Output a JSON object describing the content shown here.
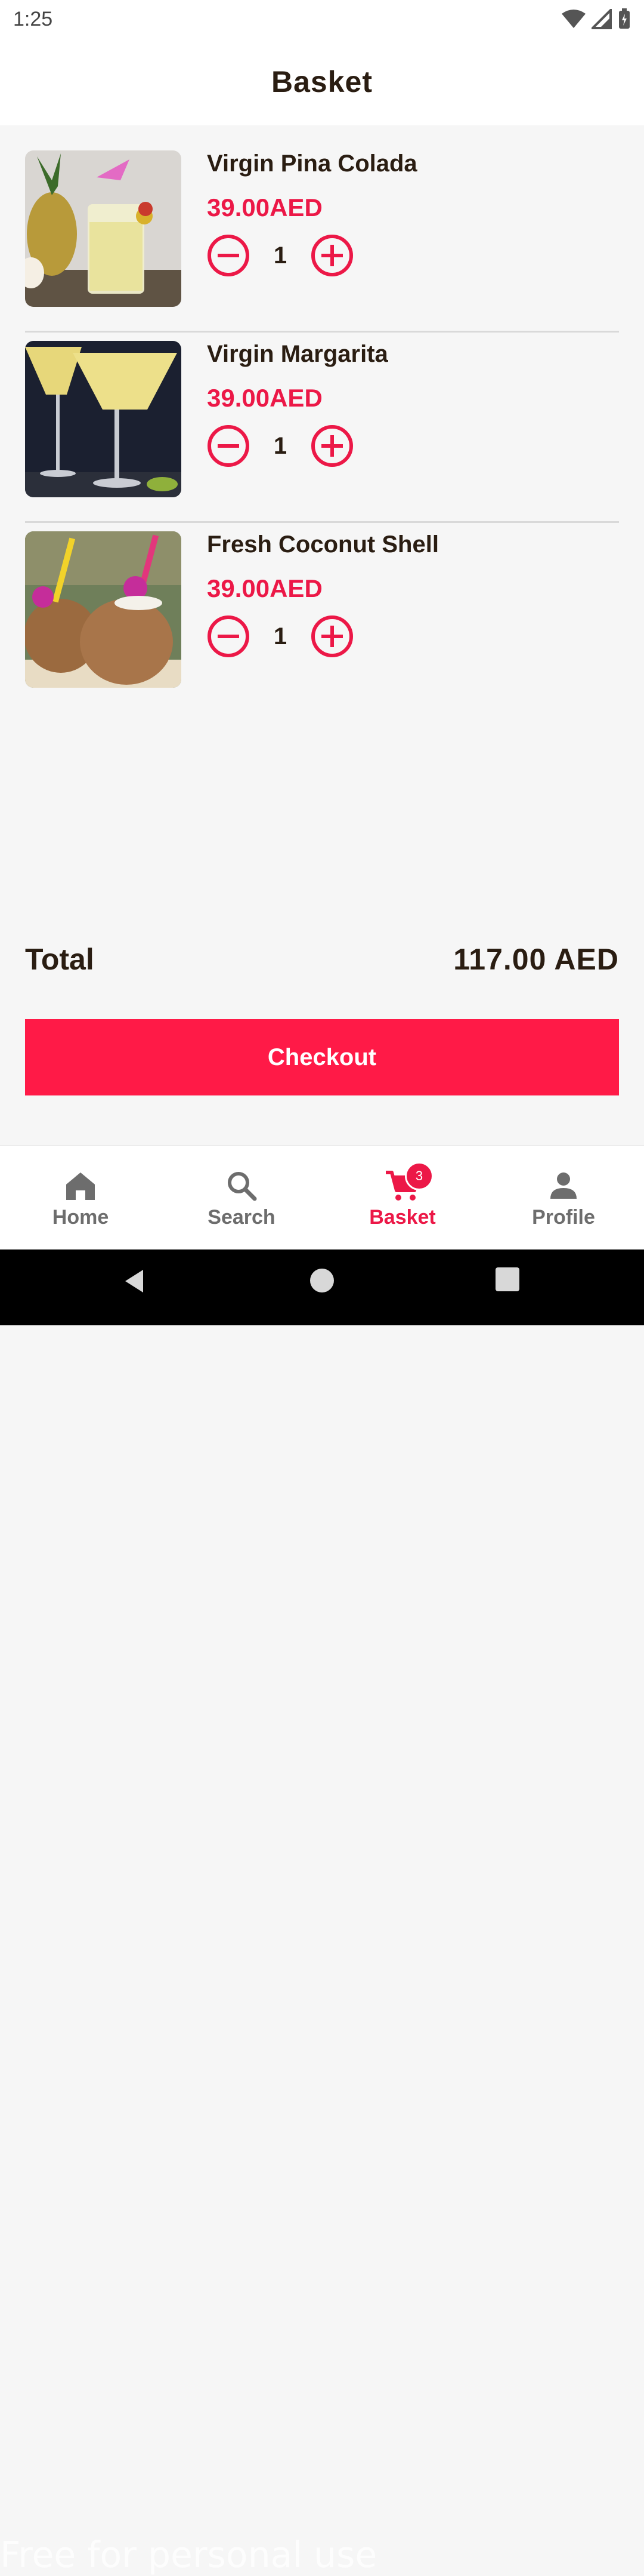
{
  "status_bar": {
    "time": "1:25"
  },
  "header": {
    "title": "Basket"
  },
  "items": [
    {
      "name": "Virgin Pina Colada",
      "price": "39.00AED",
      "quantity": "1"
    },
    {
      "name": "Virgin Margarita",
      "price": "39.00AED",
      "quantity": "1"
    },
    {
      "name": "Fresh Coconut Shell",
      "price": "39.00AED",
      "quantity": "1"
    }
  ],
  "summary": {
    "total_label": "Total",
    "total_value": "117.00 AED"
  },
  "checkout": {
    "label": "Checkout"
  },
  "bottom_nav": {
    "items": [
      {
        "label": "Home",
        "icon": "home-icon"
      },
      {
        "label": "Search",
        "icon": "search-icon"
      },
      {
        "label": "Basket",
        "icon": "cart-icon",
        "badge": "3",
        "active": true
      },
      {
        "label": "Profile",
        "icon": "person-icon"
      }
    ]
  },
  "watermark": "Free for personal use",
  "colors": {
    "accent": "#ec1847",
    "button": "#ff1a47",
    "text": "#2a1d12"
  }
}
